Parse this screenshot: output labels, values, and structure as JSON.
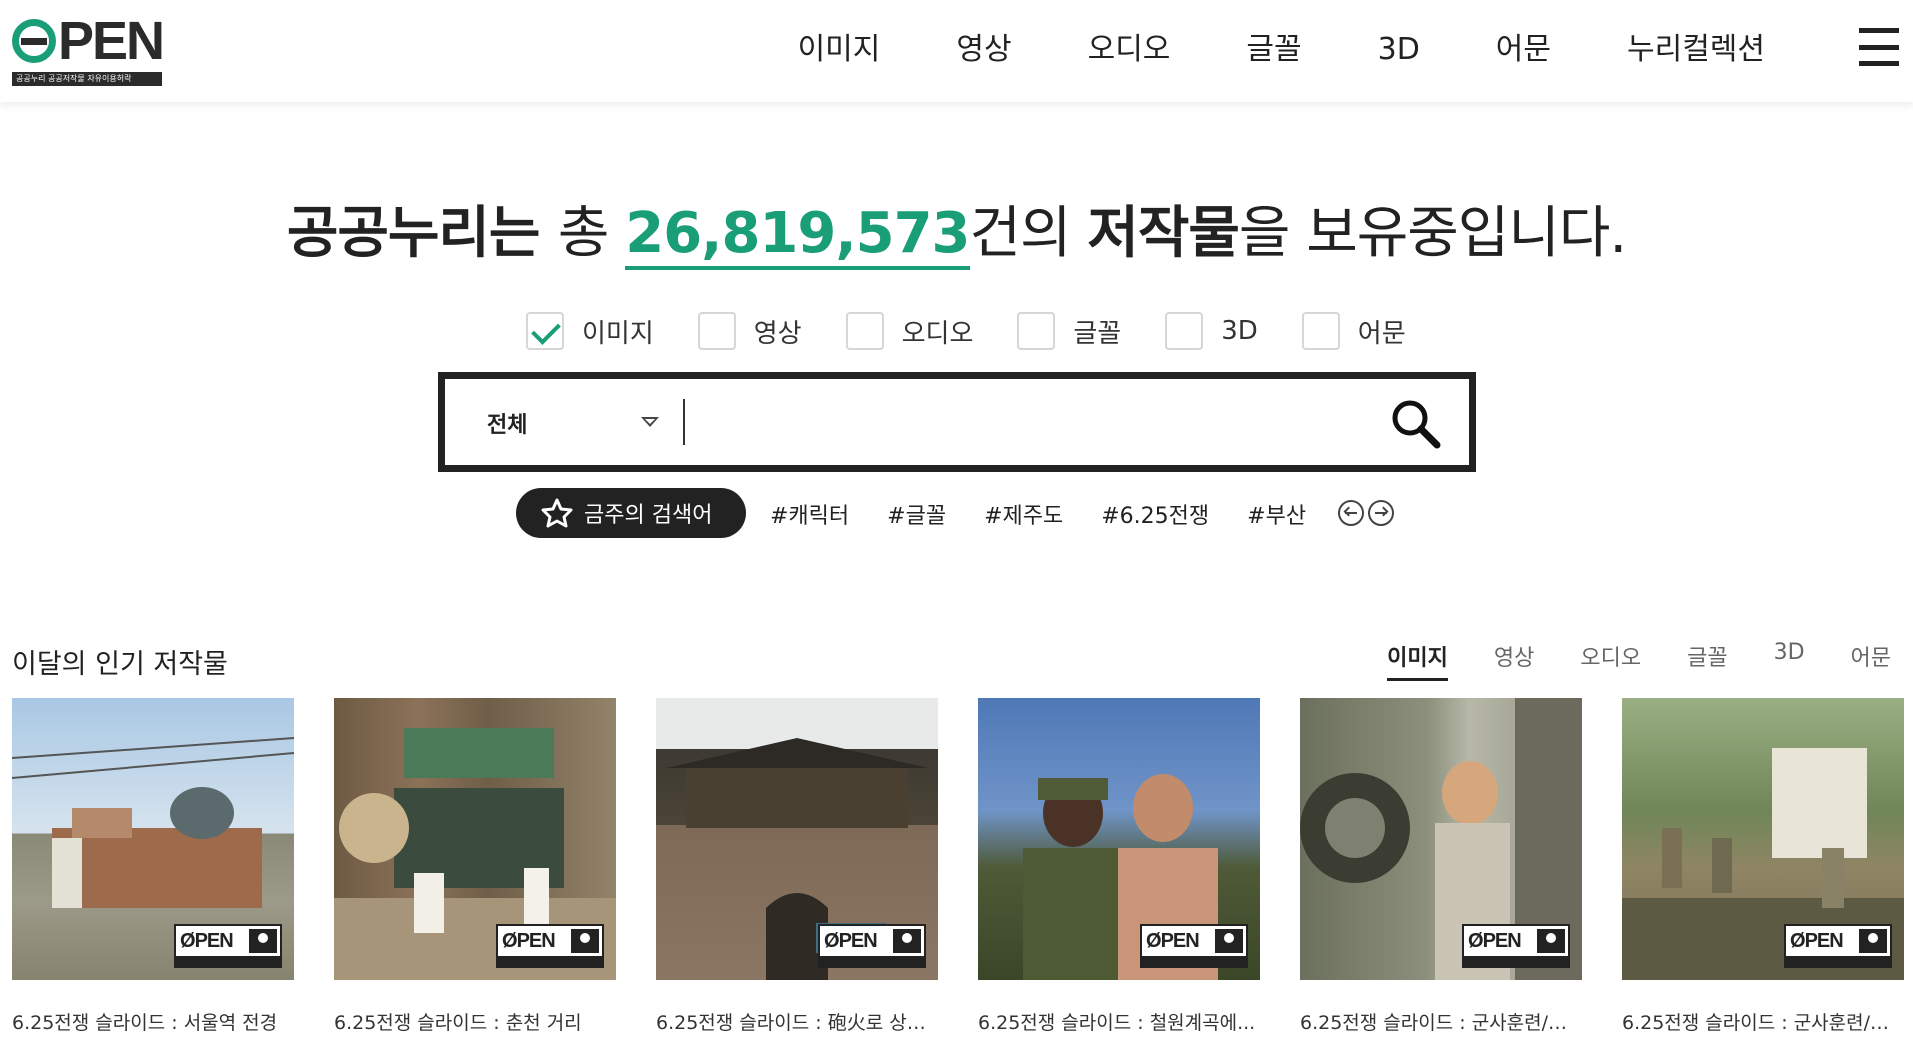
{
  "header": {
    "logo_text": "PEN",
    "logo_strip": "공공누리  공공저작물 자유이용허락",
    "nav": [
      "이미지",
      "영상",
      "오디오",
      "글꼴",
      "3D",
      "어문",
      "누리컬렉션"
    ]
  },
  "hero": {
    "prefix": "공공누리는 ",
    "mid1": "총 ",
    "count": "26,819,573",
    "mid2": "건의 ",
    "bold": "저작물",
    "suffix": "을 보유중입니다."
  },
  "filters": [
    {
      "label": "이미지",
      "checked": true
    },
    {
      "label": "영상",
      "checked": false
    },
    {
      "label": "오디오",
      "checked": false
    },
    {
      "label": "글꼴",
      "checked": false
    },
    {
      "label": "3D",
      "checked": false
    },
    {
      "label": "어문",
      "checked": false
    }
  ],
  "search": {
    "scope": "전체",
    "placeholder": ""
  },
  "weekly": {
    "label": "금주의 검색어",
    "keywords": [
      "#캐릭터",
      "#글꼴",
      "#제주도",
      "#6.25전쟁",
      "#부산"
    ]
  },
  "popular": {
    "title": "이달의 인기 저작물",
    "tabs": [
      "이미지",
      "영상",
      "오디오",
      "글꼴",
      "3D",
      "어문"
    ],
    "active_tab": 0,
    "badge_text": "PEN",
    "items": [
      {
        "title": "6.25전쟁 슬라이드 : 서울역 전경"
      },
      {
        "title": "6.25전쟁 슬라이드 : 춘천 거리"
      },
      {
        "title": "6.25전쟁 슬라이드 : 砲火로 상처..."
      },
      {
        "title": "6.25전쟁 슬라이드 : 철원계곡에..."
      },
      {
        "title": "6.25전쟁 슬라이드 : 군사훈련/군..."
      },
      {
        "title": "6.25전쟁 슬라이드 : 군사훈련/군..."
      }
    ]
  },
  "colors": {
    "accent": "#1a9e77",
    "dark": "#222222"
  }
}
